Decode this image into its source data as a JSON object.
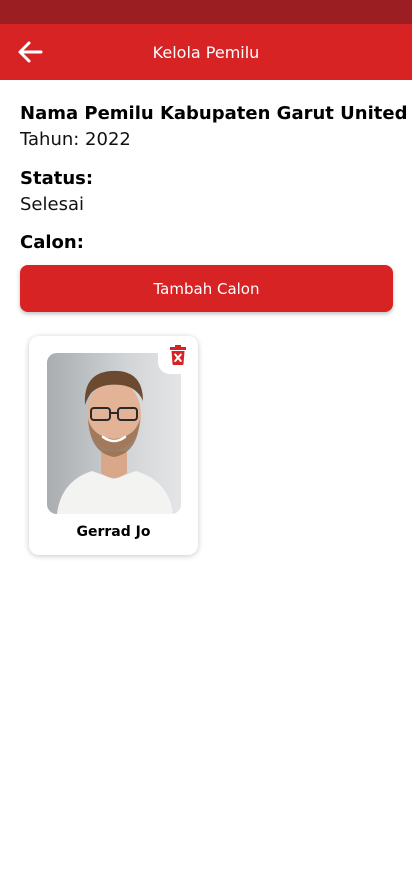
{
  "app_bar": {
    "title": "Kelola Pemilu",
    "back_icon": "arrow-left-icon"
  },
  "election": {
    "name": "Nama Pemilu Kabupaten Garut United",
    "year_line": "Tahun: 2022",
    "status_label": "Status:",
    "status_value": "Selesai",
    "candidates_label": "Calon:"
  },
  "add_button_label": "Tambah Calon",
  "candidates": [
    {
      "name": "Gerrad Jo",
      "delete_icon": "trash-x-icon"
    }
  ],
  "colors": {
    "primary": "#d72324",
    "status_bar": "#9b1e22"
  }
}
